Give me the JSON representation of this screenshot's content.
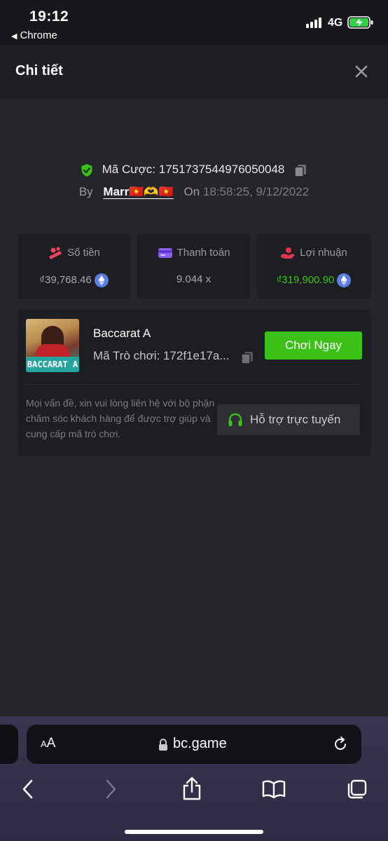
{
  "status_bar": {
    "time": "19:12",
    "back_app": "Chrome",
    "network": "4G"
  },
  "header": {
    "title": "Chi tiết"
  },
  "bet": {
    "id_label": "Mã Cược:",
    "id_value": "1751737544976050048",
    "by_label": "By",
    "user": "Marr🇻🇳🫶🇻🇳",
    "on_label": "On",
    "datetime": "18:58:25, 9/12/2022"
  },
  "stats": {
    "amount": {
      "label": "Số tiền",
      "value": "₫39,768.46",
      "color": "#a8a9ae"
    },
    "payout": {
      "label": "Thanh toán",
      "value": "9.044 x"
    },
    "profit": {
      "label": "Lợi nhuận",
      "value": "₫319,900.90",
      "color": "#3bc117"
    }
  },
  "game": {
    "thumb_label": "BACCARAT A",
    "name": "Baccarat A",
    "id_label": "Mã Trò chơi:",
    "id_value": "172f1e17a...",
    "play_label": "Chơi Ngay",
    "help_text": "Mọi vấn đề, xin vui lòng liên hệ với bộ phận chăm sóc khách hàng để được trợ giúp và cung cấp mã trò chơi.",
    "support_label": "Hỗ trợ trực tuyến"
  },
  "browser": {
    "aa": "AA",
    "url": "bc.game"
  },
  "colors": {
    "accent_green": "#3bc117",
    "background": "#24262b",
    "panel": "#1d1e22"
  }
}
